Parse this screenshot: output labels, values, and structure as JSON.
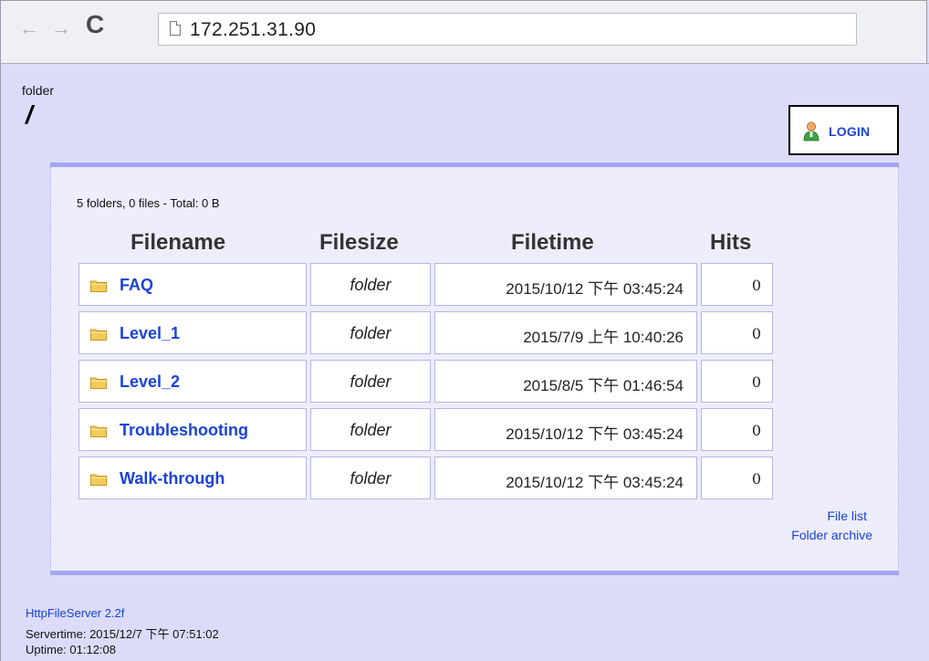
{
  "browser": {
    "url": "172.251.31.90",
    "back_icon": "←",
    "forward_icon": "→",
    "reload_icon": "C"
  },
  "header": {
    "folder_label": "folder",
    "path": "/"
  },
  "login": {
    "label": "LOGIN",
    "icon": "user-icon"
  },
  "summary": "5 folders, 0 files - Total: 0 B",
  "table": {
    "columns": [
      "Filename",
      "Filesize",
      "Filetime",
      "Hits"
    ],
    "rows": [
      {
        "name": "FAQ",
        "size": "folder",
        "time": "2015/10/12 下午 03:45:24",
        "hits": "0"
      },
      {
        "name": "Level_1",
        "size": "folder",
        "time": "2015/7/9 上午 10:40:26",
        "hits": "0"
      },
      {
        "name": "Level_2",
        "size": "folder",
        "time": "2015/8/5 下午 01:46:54",
        "hits": "0"
      },
      {
        "name": "Troubleshooting",
        "size": "folder",
        "time": "2015/10/12 下午 03:45:24",
        "hits": "0"
      },
      {
        "name": "Walk-through",
        "size": "folder",
        "time": "2015/10/12 下午 03:45:24",
        "hits": "0"
      }
    ]
  },
  "links": {
    "file_list": "File list",
    "folder_archive": "Folder archive"
  },
  "footer": {
    "server": "HttpFileServer 2.2f",
    "servertime": "Servertime: 2015/12/7 下午 07:51:02",
    "uptime": "Uptime: 01:12:08"
  },
  "colors": {
    "page_bg": "#dcdcfa",
    "panel_bg": "#ededfc",
    "panel_border": "#a5a5f3",
    "link": "#1a43d8",
    "folder_icon": "#f2cc5a"
  }
}
